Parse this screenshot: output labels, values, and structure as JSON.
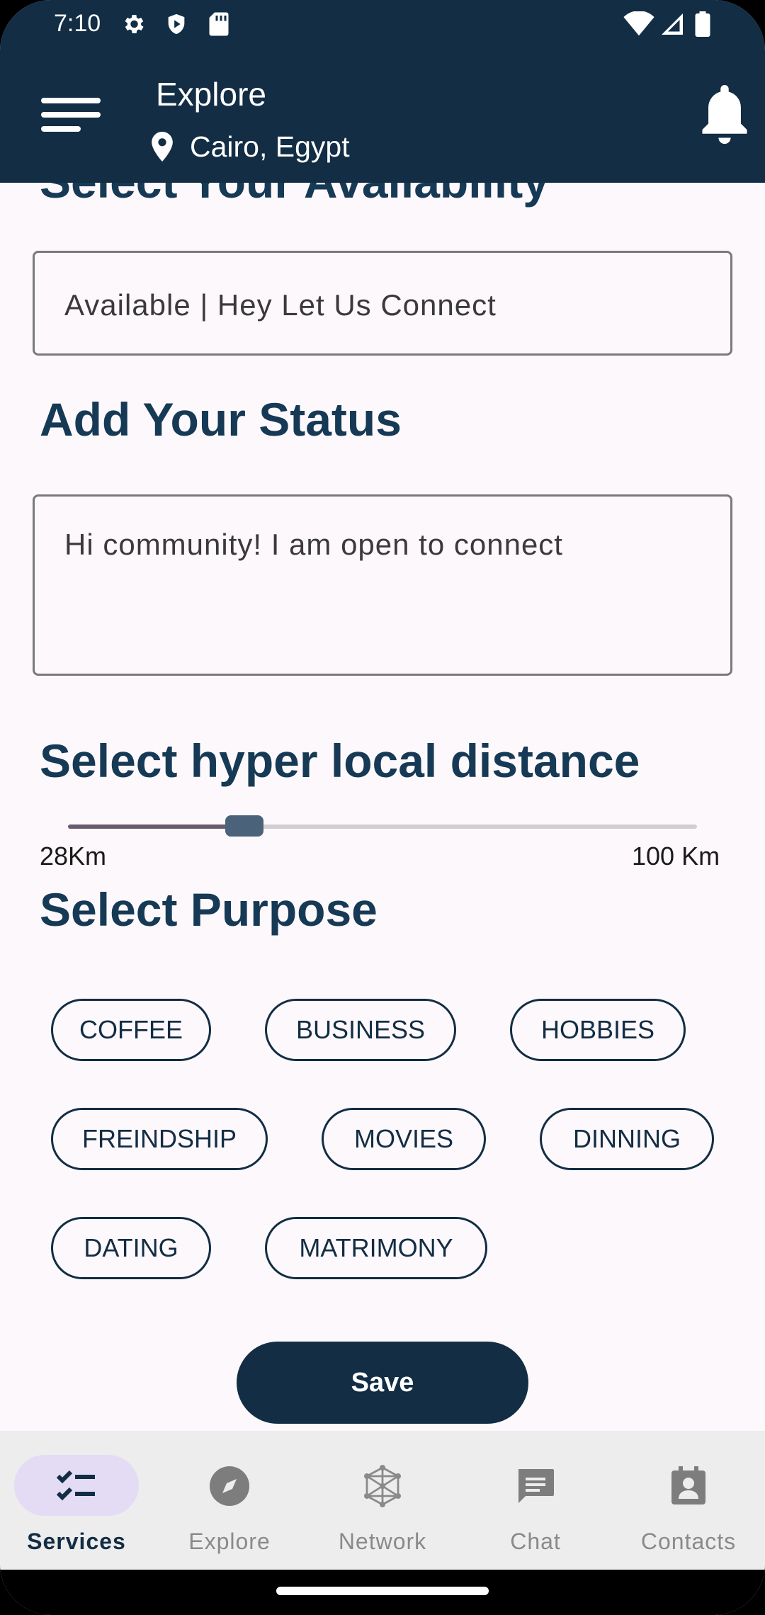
{
  "status_bar": {
    "time": "7:10"
  },
  "header": {
    "title": "Explore",
    "location": "Cairo, Egypt"
  },
  "sections": {
    "availability_title": "Select Your Availability",
    "availability_value": "Available | Hey Let Us Connect",
    "status_title": "Add Your Status",
    "status_value": "Hi community! I am open to connect",
    "distance_title": "Select hyper local distance",
    "distance_min_label": "28Km",
    "distance_max_label": "100 Km",
    "distance_fraction": 0.28,
    "purpose_title": "Select Purpose"
  },
  "purposes": [
    "COFFEE",
    "BUSINESS",
    "HOBBIES",
    "FREINDSHIP",
    "MOVIES",
    "DINNING",
    "DATING",
    "MATRIMONY"
  ],
  "save_label": "Save",
  "nav": {
    "active": "Services",
    "items": [
      {
        "label": "Services",
        "icon": "checklist-icon"
      },
      {
        "label": "Explore",
        "icon": "compass-icon"
      },
      {
        "label": "Network",
        "icon": "network-icon"
      },
      {
        "label": "Chat",
        "icon": "chat-icon"
      },
      {
        "label": "Contacts",
        "icon": "contacts-icon"
      }
    ]
  },
  "colors": {
    "primary": "#122d44",
    "heading": "#163a55",
    "background": "#fdf8fb",
    "nav_active_pill": "#e3dcf4"
  }
}
